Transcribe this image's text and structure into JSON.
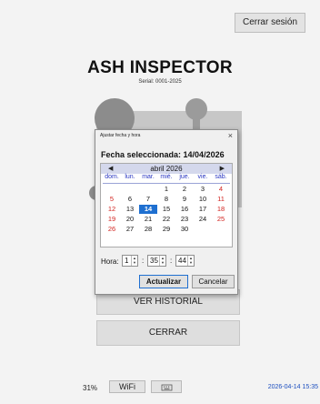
{
  "header": {
    "logout_label": "Cerrar sesión"
  },
  "app": {
    "title": "ASH INSPECTOR",
    "serial": "Serial: 0001-2025"
  },
  "buttons": {
    "history_label": "VER HISTORIAL",
    "close_label": "CERRAR"
  },
  "dialog": {
    "title": "Ajustar fecha y hora",
    "close_glyph": "×",
    "selected_label": "Fecha seleccionada: 14/04/2026",
    "calendar": {
      "month_label": "abril 2026",
      "prev_glyph": "◀",
      "next_glyph": "▶",
      "weekdays": [
        "dom.",
        "lun.",
        "mar.",
        "mié.",
        "jue.",
        "vie.",
        "sáb."
      ],
      "selected_day": 14,
      "rows": [
        [
          "",
          "",
          "",
          "1",
          "2",
          "3",
          "4"
        ],
        [
          "5",
          "6",
          "7",
          "8",
          "9",
          "10",
          "11"
        ],
        [
          "12",
          "13",
          "14",
          "15",
          "16",
          "17",
          "18"
        ],
        [
          "19",
          "20",
          "21",
          "22",
          "23",
          "24",
          "25"
        ],
        [
          "26",
          "27",
          "28",
          "29",
          "30",
          "",
          ""
        ]
      ]
    },
    "time": {
      "label": "Hora:",
      "hour": "1",
      "minute": "35",
      "second": "44",
      "separator": ":"
    },
    "update_label": "Actualizar",
    "cancel_label": "Cancelar"
  },
  "status_bar": {
    "battery": "31%",
    "wifi_label": "WiFi",
    "keyboard_icon": "keyboard-icon",
    "datetime": "2026-04-14 15:35"
  },
  "colors": {
    "accent": "#1e6fd0",
    "weekend_red": "#d2231f",
    "weekday_header_blue": "#2a37c2",
    "clock_blue": "#1d4fbf"
  }
}
